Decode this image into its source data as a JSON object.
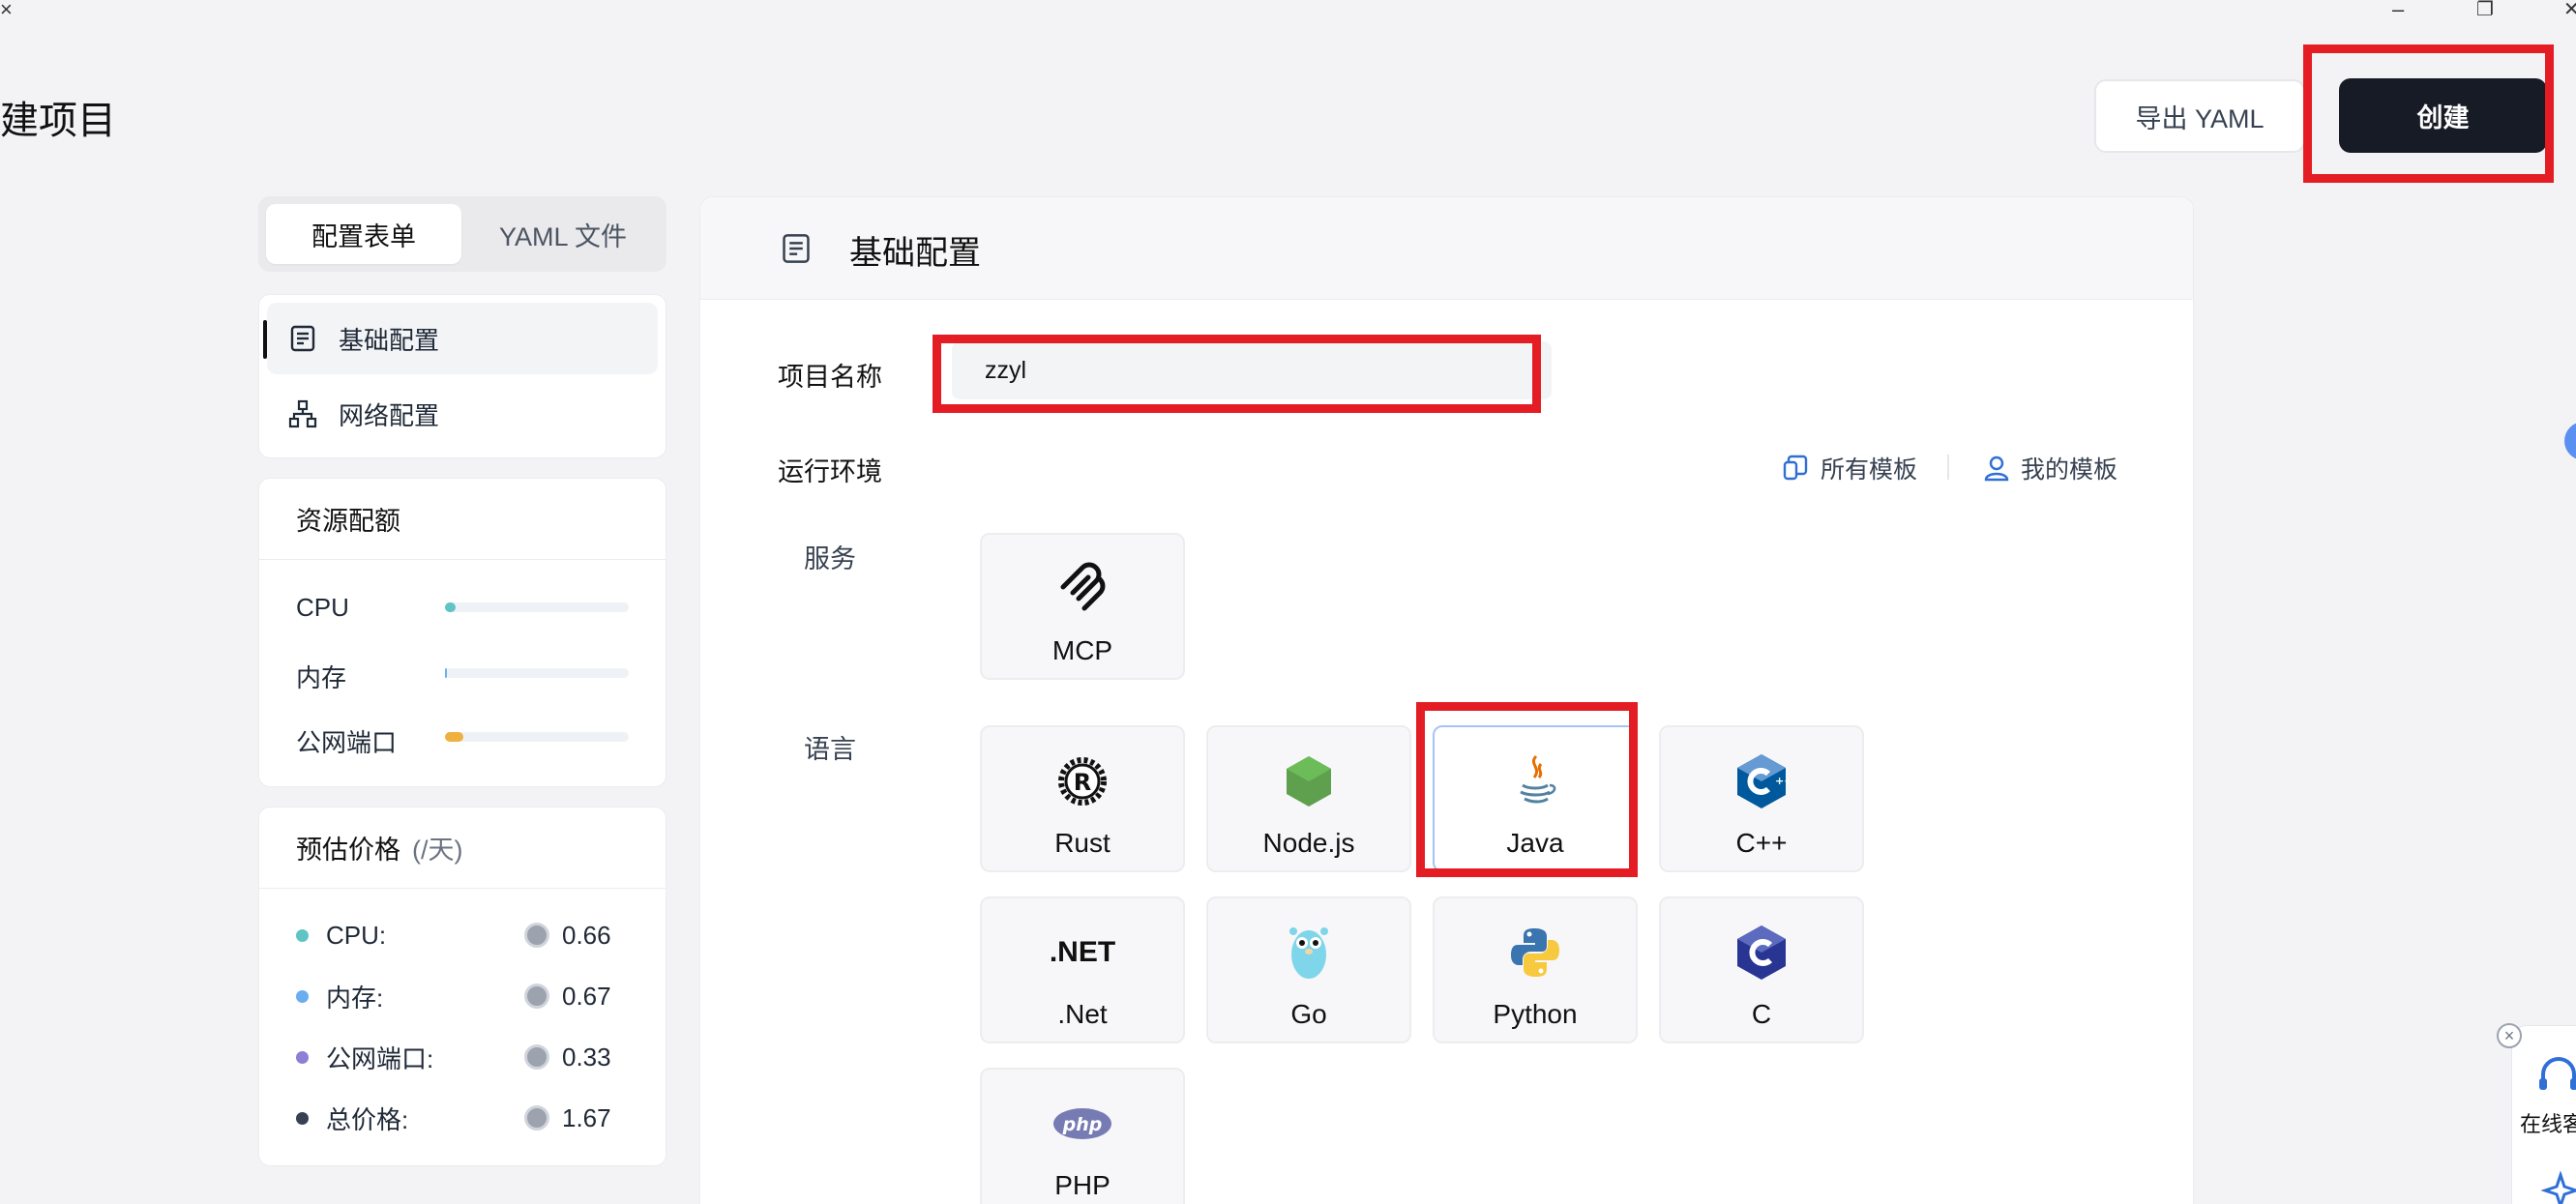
{
  "window": {
    "close_left": "×",
    "minimize": "–",
    "restore": "❐",
    "close": "✕"
  },
  "header": {
    "title": "建项目",
    "export_label": "导出 YAML",
    "create_label": "创建"
  },
  "mode_tabs": [
    {
      "label": "配置表单",
      "active": true
    },
    {
      "label": "YAML 文件",
      "active": false
    }
  ],
  "nav": {
    "items": [
      {
        "label": "基础配置",
        "icon": "form-icon",
        "active": true
      },
      {
        "label": "网络配置",
        "icon": "network-icon",
        "active": false
      }
    ]
  },
  "resources": {
    "title": "资源配额",
    "rows": [
      {
        "label": "CPU",
        "fill": 0.06,
        "color": "#5fc4c4"
      },
      {
        "label": "内存",
        "fill": 0.01,
        "color": "#6aaef0"
      },
      {
        "label": "公网端口",
        "fill": 0.1,
        "color": "#f0b040"
      }
    ]
  },
  "price": {
    "title": "预估价格",
    "unit": "(/天)",
    "rows": [
      {
        "label": "CPU:",
        "value": "0.66",
        "color": "#5fc4c4"
      },
      {
        "label": "内存:",
        "value": "0.67",
        "color": "#6aaef0"
      },
      {
        "label": "公网端口:",
        "value": "0.33",
        "color": "#8b7fd6"
      },
      {
        "label": "总价格:",
        "value": "1.67",
        "color": "#374151"
      }
    ]
  },
  "main": {
    "title": "基础配置",
    "name_label": "项目名称",
    "name_value": "zzyl",
    "runtime_label": "运行环境",
    "all_templates": "所有模板",
    "my_templates": "我的模板",
    "service_label": "服务",
    "language_label": "语言",
    "services": [
      {
        "label": "MCP",
        "icon": "mcp-icon"
      }
    ],
    "languages": [
      {
        "label": "Rust",
        "icon": "rust-icon"
      },
      {
        "label": "Node.js",
        "icon": "nodejs-icon"
      },
      {
        "label": "Java",
        "icon": "java-icon",
        "selected": true
      },
      {
        "label": "C++",
        "icon": "cpp-icon"
      },
      {
        "label": ".Net",
        "icon": "dotnet-icon",
        "icon_text": ".NET"
      },
      {
        "label": "Go",
        "icon": "go-gopher-icon"
      },
      {
        "label": "Python",
        "icon": "python-icon"
      },
      {
        "label": "C",
        "icon": "c-icon"
      },
      {
        "label": "PHP",
        "icon": "php-icon",
        "icon_text": "php"
      }
    ]
  },
  "widget": {
    "label": "在线客"
  }
}
